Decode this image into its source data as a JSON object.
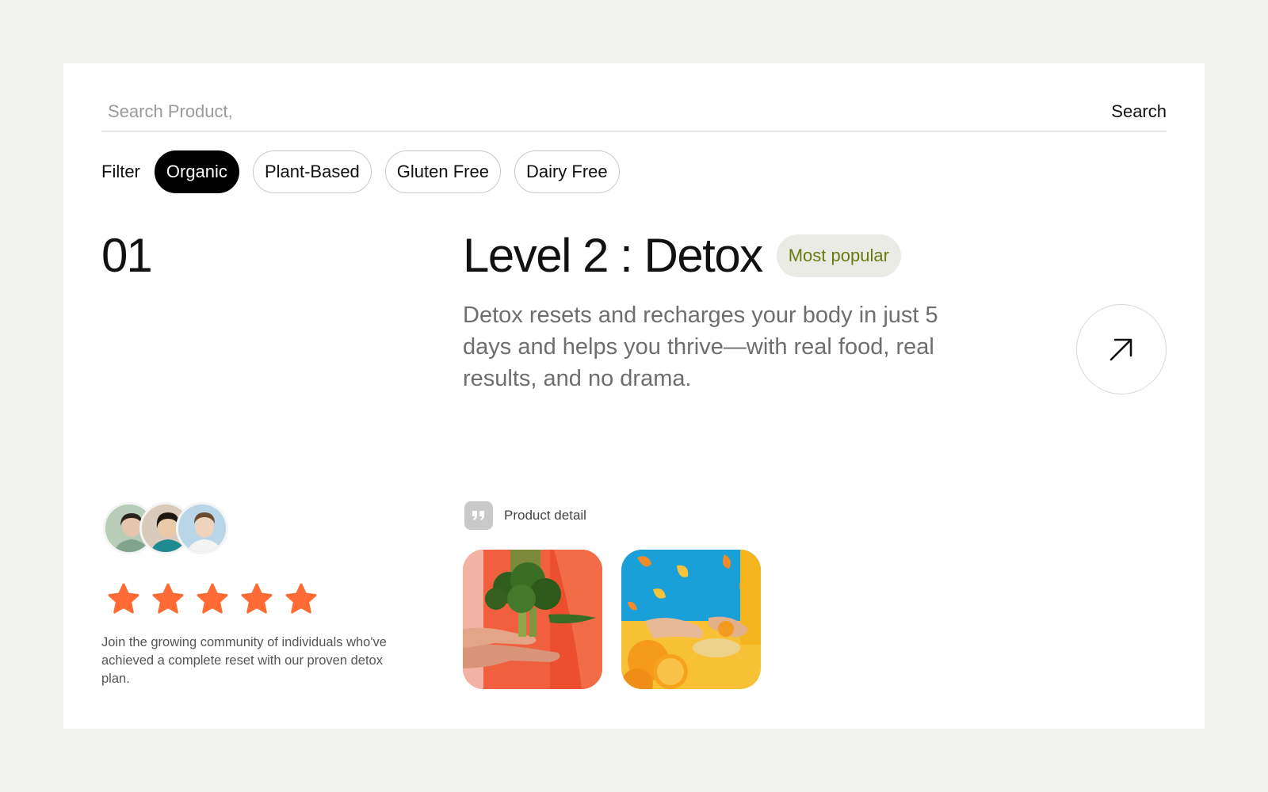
{
  "search": {
    "placeholder": "Search Product,",
    "value": "",
    "button_label": "Search"
  },
  "filters": {
    "label": "Filter",
    "chips": [
      {
        "label": "Organic",
        "active": true
      },
      {
        "label": "Plant-Based",
        "active": false
      },
      {
        "label": "Gluten Free",
        "active": false
      },
      {
        "label": "Dairy Free",
        "active": false
      }
    ]
  },
  "product": {
    "number": "01",
    "title": "Level 2 : Detox",
    "badge": "Most popular",
    "description": "Detox resets and recharges your body in just 5 days  and helps you thrive—with real food, real results, and no drama.",
    "detail_label": "Product detail"
  },
  "community": {
    "rating": 5,
    "rating_max": 5,
    "text": "Join the growing community of individuals who've achieved a complete reset with our proven detox plan."
  },
  "icons": {
    "arrow": "arrow-up-right-icon",
    "star": "star-icon",
    "quote": "quote-icon"
  },
  "colors": {
    "background": "#f2f3f1",
    "card": "#ffffff",
    "chip_active_bg": "#000000",
    "badge_bg": "#ebebe5",
    "badge_text": "#6a7a13",
    "star": "#ff6b35"
  }
}
